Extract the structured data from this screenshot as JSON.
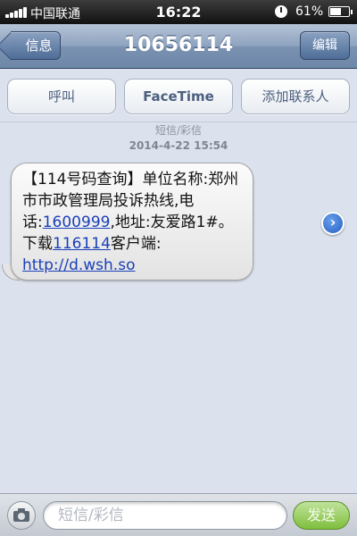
{
  "status_bar": {
    "carrier": "中国联通",
    "time": "16:22",
    "battery_percent": "61%",
    "battery_level": 0.61,
    "signal_icon": "signal-bars-icon",
    "lock_icon": "rotation-lock-icon"
  },
  "nav": {
    "back_label": "信息",
    "title": "10656114",
    "edit_label": "编辑"
  },
  "actions": {
    "call": "呼叫",
    "facetime": "FaceTime",
    "add_contact": "添加联系人"
  },
  "thread": {
    "message_type": "短信/彩信",
    "timestamp": "2014-4-22 15:54",
    "message": {
      "part1": "【114号码查询】单位名称:郑州市市政管理局投诉热线,电话:",
      "phone": "1600999",
      "part2": ",地址:友爱路1#。下载",
      "code": "116114",
      "part3": "客户端: ",
      "url": "http://d.wsh.so"
    }
  },
  "composer": {
    "placeholder": "短信/彩信",
    "send_label": "发送",
    "camera_icon": "camera-icon"
  },
  "colors": {
    "nav_bar": "#7b92b2",
    "background": "#dbe2ed",
    "link": "#1a3fb8",
    "send_button": "#7fbf3d"
  }
}
